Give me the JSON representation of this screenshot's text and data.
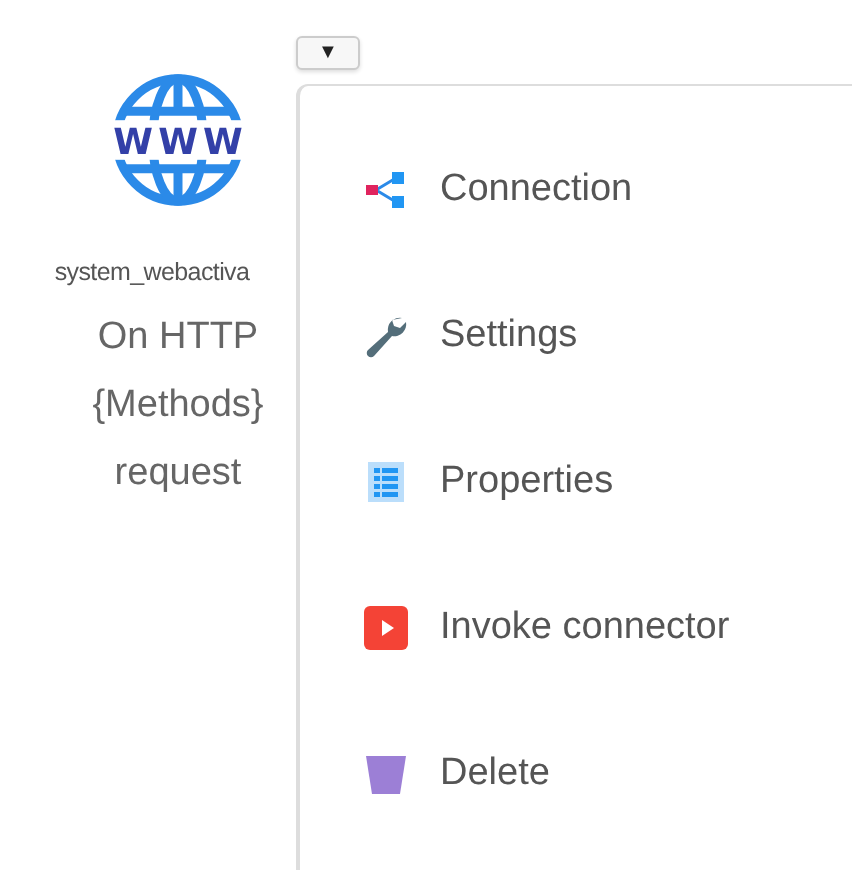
{
  "node": {
    "icon_label": "WWW",
    "name": "system_webactiva",
    "title_lines": [
      "On HTTP",
      "{Methods}",
      "request"
    ]
  },
  "dropdown": {
    "glyph": "▼"
  },
  "menu": {
    "items": [
      {
        "kind": "connection",
        "label": "Connection"
      },
      {
        "kind": "settings",
        "label": "Settings"
      },
      {
        "kind": "properties",
        "label": "Properties"
      },
      {
        "kind": "invoke",
        "label": "Invoke connector"
      },
      {
        "kind": "delete",
        "label": "Delete"
      }
    ]
  }
}
